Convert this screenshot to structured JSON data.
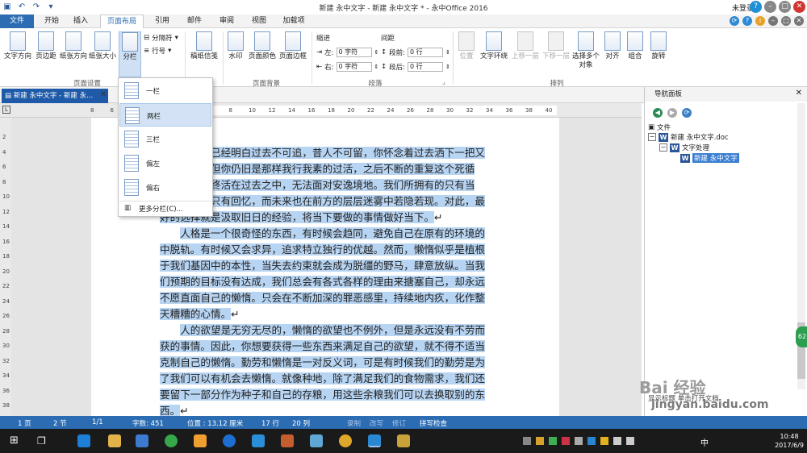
{
  "window": {
    "title": "新建 永中文字 - 新建 永中文字 * - 永中Office 2016",
    "login": "未登录",
    "controls": [
      "help-icon",
      "minimize-icon",
      "restore-icon",
      "close-icon"
    ]
  },
  "qat": [
    "save-icon",
    "undo-icon",
    "redo-icon",
    "customize-icon"
  ],
  "menu": {
    "file": "文件",
    "tabs": [
      "开始",
      "插入",
      "页面布局",
      "引用",
      "邮件",
      "审阅",
      "视图",
      "加载项"
    ],
    "active_tab": "页面布局"
  },
  "ribbon": {
    "page_setup": {
      "label": "页面设置",
      "buttons": [
        "文字方向",
        "页边距",
        "纸张方向",
        "纸张大小",
        "分栏"
      ],
      "small": [
        "分隔符",
        "行号"
      ]
    },
    "manuscript": {
      "button": "稿纸信笺"
    },
    "page_background": {
      "label": "页面背景",
      "buttons": [
        "水印",
        "页面颜色",
        "页面边框"
      ]
    },
    "paragraph": {
      "label": "段落",
      "indent_header": "缩进",
      "spacing_header": "间距",
      "indent_left_label": "左:",
      "indent_left_value": "0 字符",
      "indent_right_label": "右:",
      "indent_right_value": "0 字符",
      "space_before_label": "段前:",
      "space_before_value": "0 行",
      "space_after_label": "段后:",
      "space_after_value": "0 行"
    },
    "arrange": {
      "label": "排列",
      "buttons": [
        "位置",
        "文字环绕",
        "上移一层",
        "下移一层",
        "选择多个对象",
        "对齐",
        "组合",
        "旋转"
      ]
    }
  },
  "columns_dropdown": {
    "items": [
      "一栏",
      "两栏",
      "三栏",
      "偏左",
      "偏右"
    ],
    "hovered": "两栏",
    "more": "更多分栏(C)..."
  },
  "doc_tab": {
    "label": "新建 永中文字 - 新建 永..."
  },
  "ruler": {
    "h_ticks": [
      "8",
      "6",
      "4",
      "2",
      "2",
      "4",
      "6",
      "8",
      "10",
      "12",
      "14",
      "16",
      "18",
      "20",
      "22",
      "24",
      "26",
      "28",
      "30",
      "32",
      "34",
      "36",
      "38",
      "40"
    ],
    "v_ticks": [
      "2",
      "4",
      "6",
      "8",
      "10",
      "12",
      "14",
      "16",
      "18",
      "20",
      "22",
      "24",
      "26",
      "28",
      "30",
      "32",
      "34",
      "36",
      "38"
    ]
  },
  "document": {
    "paragraphs": [
      "也许你已经明白过去不可追，昔人不可留，你怀念着过去洒下一把又一把热泪，但你仍旧是那样我行我素的过活，之后不断的重复这个死循环，让你始终活在过去之中，无法面对安逸境地。我们所拥有的只有当下，过往里只有回忆，而未来也在前方的层层迷雾中若隐若现。对此，最好的选择就是汲取旧日的经验，将当下要做的事情做好当下。",
      "人格是一个很奇怪的东西，有时候会趋同，避免自己在原有的环境的中脱轨。有时候又会求异，追求特立独行的优越。然而，懒惰似乎是植根于我们基因中的本性，当失去约束就会成为脱缰的野马，肆意放纵。当我们预期的目标没有达成，我们总会有各式各样的理由来搪塞自己，却永远不愿直面自己的懒惰。只会在不断加深的罪恶感里，持续地内疚，化作整天糟糟的心情。",
      "人的欲望是无穷无尽的，懒惰的欲望也不例外，但是永远没有不劳而获的事情。因此，你想要获得一些东西来满足自己的欲望，就不得不适当克制自己的懒惰。勤劳和懒惰是一对反义词，可是有时候我们的勤劳是为了我们可以有机会去懒惰。就像种地，除了满足我们的食物需求，我们还要留下一部分作为种子和自己的存粮，用这些余粮我们可以去换取别的东西。"
    ]
  },
  "nav_pane": {
    "title": "导航面板",
    "tree": [
      "文件",
      "新建 永中文字.doc",
      "文字处理",
      "新建 永中文字"
    ],
    "bottom": "显示标题  单击打开文档"
  },
  "statusbar": {
    "page": "1 页",
    "section": "2 节",
    "pages": "1/1",
    "words": "字数: 451",
    "position": "位置 : 13.12 厘米",
    "line": "17 行",
    "col": "20 列",
    "record": "录制",
    "overwrite": "改写",
    "revise": "修订",
    "spell": "拼写检查"
  },
  "taskbar": {
    "time": "10:48",
    "date": "2017/6/9",
    "ime": "中",
    "badge": "62"
  },
  "watermark": {
    "brand": "Bai 经验",
    "url": "jingyan.baidu.com"
  }
}
